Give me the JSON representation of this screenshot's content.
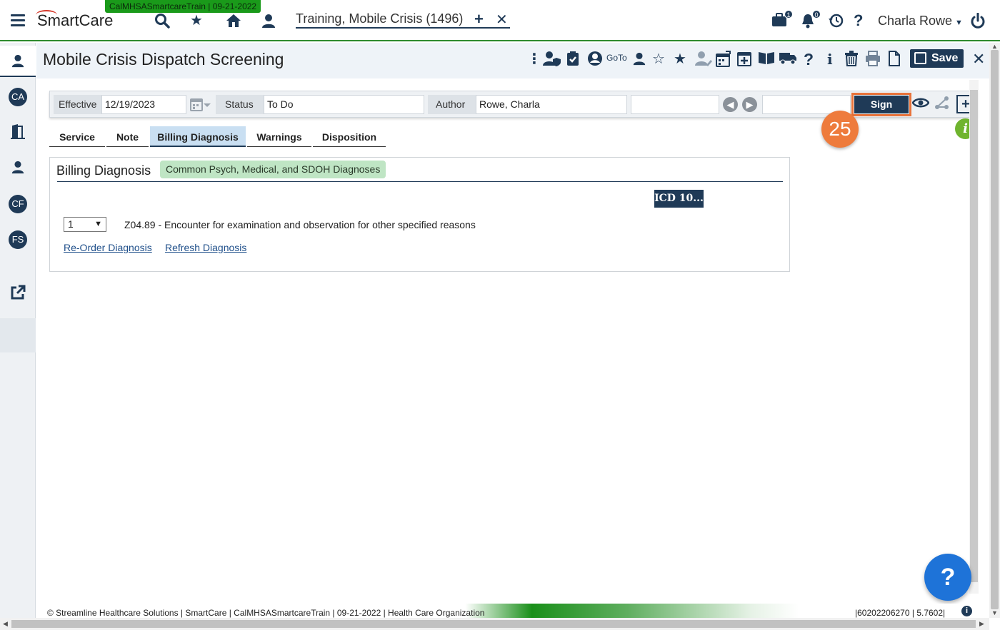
{
  "env_badge": "CalMHSASmartcareTrain | 09-21-2022",
  "logo_text": "SmartCare",
  "client_tab": {
    "label": "Training, Mobile Crisis (1496)"
  },
  "topbar": {
    "user_name": "Charla Rowe",
    "briefcase_count": "1",
    "bell_count": "0"
  },
  "sidebar": {
    "items": [
      "CA",
      "CF",
      "FS"
    ]
  },
  "header": {
    "title": "Mobile Crisis Dispatch Screening",
    "goto_label": "GoTo",
    "save_label": "Save"
  },
  "docbar": {
    "effective_label": "Effective",
    "effective_value": "12/19/2023",
    "status_label": "Status",
    "status_value": "To Do",
    "author_label": "Author",
    "author_value": "Rowe, Charla",
    "sign_label": "Sign"
  },
  "step_number": "25",
  "tabs": [
    {
      "label": "Service"
    },
    {
      "label": "Note"
    },
    {
      "label": "Billing Diagnosis"
    },
    {
      "label": "Warnings"
    },
    {
      "label": "Disposition"
    }
  ],
  "panel": {
    "title": "Billing Diagnosis",
    "pill": "Common Psych, Medical, and SDOH Diagnoses",
    "icd_button": "ICD 10...",
    "order_value": "1",
    "diagnosis_text": "Z04.89 - Encounter for examination and observation for other specified reasons",
    "reorder_link": "Re-Order Diagnosis",
    "refresh_link": "Refresh Diagnosis"
  },
  "footer": {
    "left_text": "© Streamline Healthcare Solutions | SmartCare | CalMHSASmartcareTrain | 09-21-2022 | Health Care Organization",
    "right_text": "|60202206270 | 5.7602|"
  },
  "colors": {
    "primary": "#1f3a57",
    "accent_orange": "#ee7b3c",
    "env_green": "#1a9a1a",
    "pill_green": "#bfe5c4"
  }
}
